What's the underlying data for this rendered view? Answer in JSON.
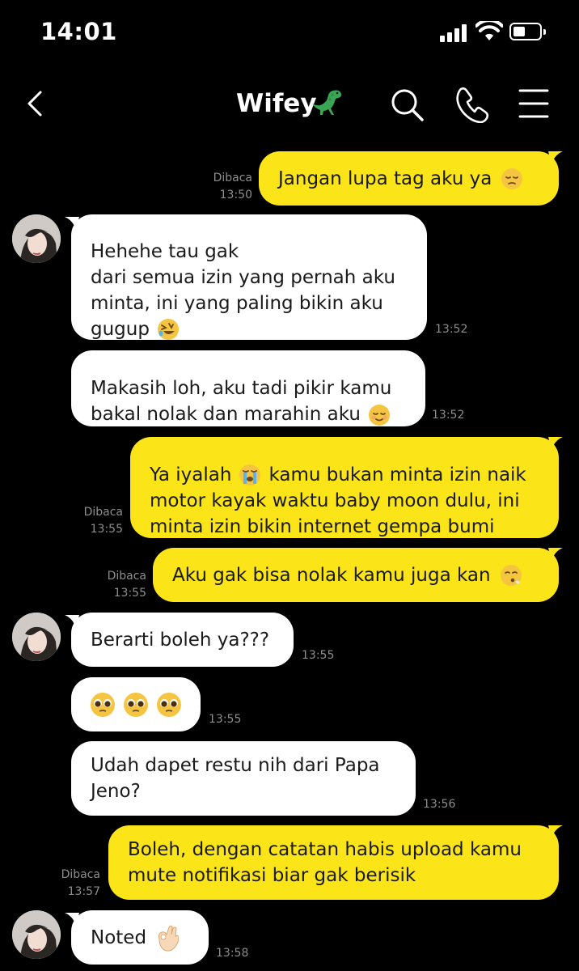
{
  "status": {
    "time": "14:01"
  },
  "header": {
    "title": "Wifey",
    "title_emoji": "dinosaur"
  },
  "messages": [
    {
      "id": "m1",
      "dir": "out",
      "text": "Jangan lupa tag aku ya",
      "emoji": "pensive-face",
      "read": "Dibaca",
      "time": "13:50"
    },
    {
      "id": "m2",
      "dir": "in",
      "text": "Hehehe tau gak\ndari semua izin yang pernah aku minta, ini yang paling bikin aku gugup",
      "emoji": "rolling-laughing-face",
      "time": "13:52"
    },
    {
      "id": "m3",
      "dir": "in",
      "text": "Makasih loh, aku tadi pikir kamu bakal nolak dan marahin aku",
      "emoji": "relieved-face",
      "time": "13:52"
    },
    {
      "id": "m4",
      "dir": "out",
      "text_a": "Ya iyalah",
      "emoji": "loudly-crying-face",
      "text_b": "kamu bukan minta izin naik motor kayak waktu baby moon dulu, ini minta izin bikin internet gempa bumi",
      "read": "Dibaca",
      "time": "13:55"
    },
    {
      "id": "m5",
      "dir": "out",
      "text": "Aku gak bisa nolak kamu juga kan",
      "emoji": "sighing-face",
      "read": "Dibaca",
      "time": "13:55"
    },
    {
      "id": "m6",
      "dir": "in",
      "text": "Berarti boleh ya???",
      "time": "13:55"
    },
    {
      "id": "m7",
      "dir": "in",
      "emoji_only": "pleading-face x3",
      "time": "13:55"
    },
    {
      "id": "m8",
      "dir": "in",
      "text": "Udah dapet restu nih dari Papa Jeno?",
      "time": "13:56"
    },
    {
      "id": "m9",
      "dir": "out",
      "text": "Boleh, dengan catatan habis upload kamu mute notifikasi biar gak berisik",
      "read": "Dibaca",
      "time": "13:57"
    },
    {
      "id": "m10",
      "dir": "in",
      "text": "Noted",
      "emoji": "ok-hand",
      "time": "13:58"
    }
  ],
  "colors": {
    "outgoing_bubble": "#fbe417",
    "incoming_bubble": "#ffffff",
    "background": "#000000",
    "meta_text": "#8e8e8e"
  }
}
